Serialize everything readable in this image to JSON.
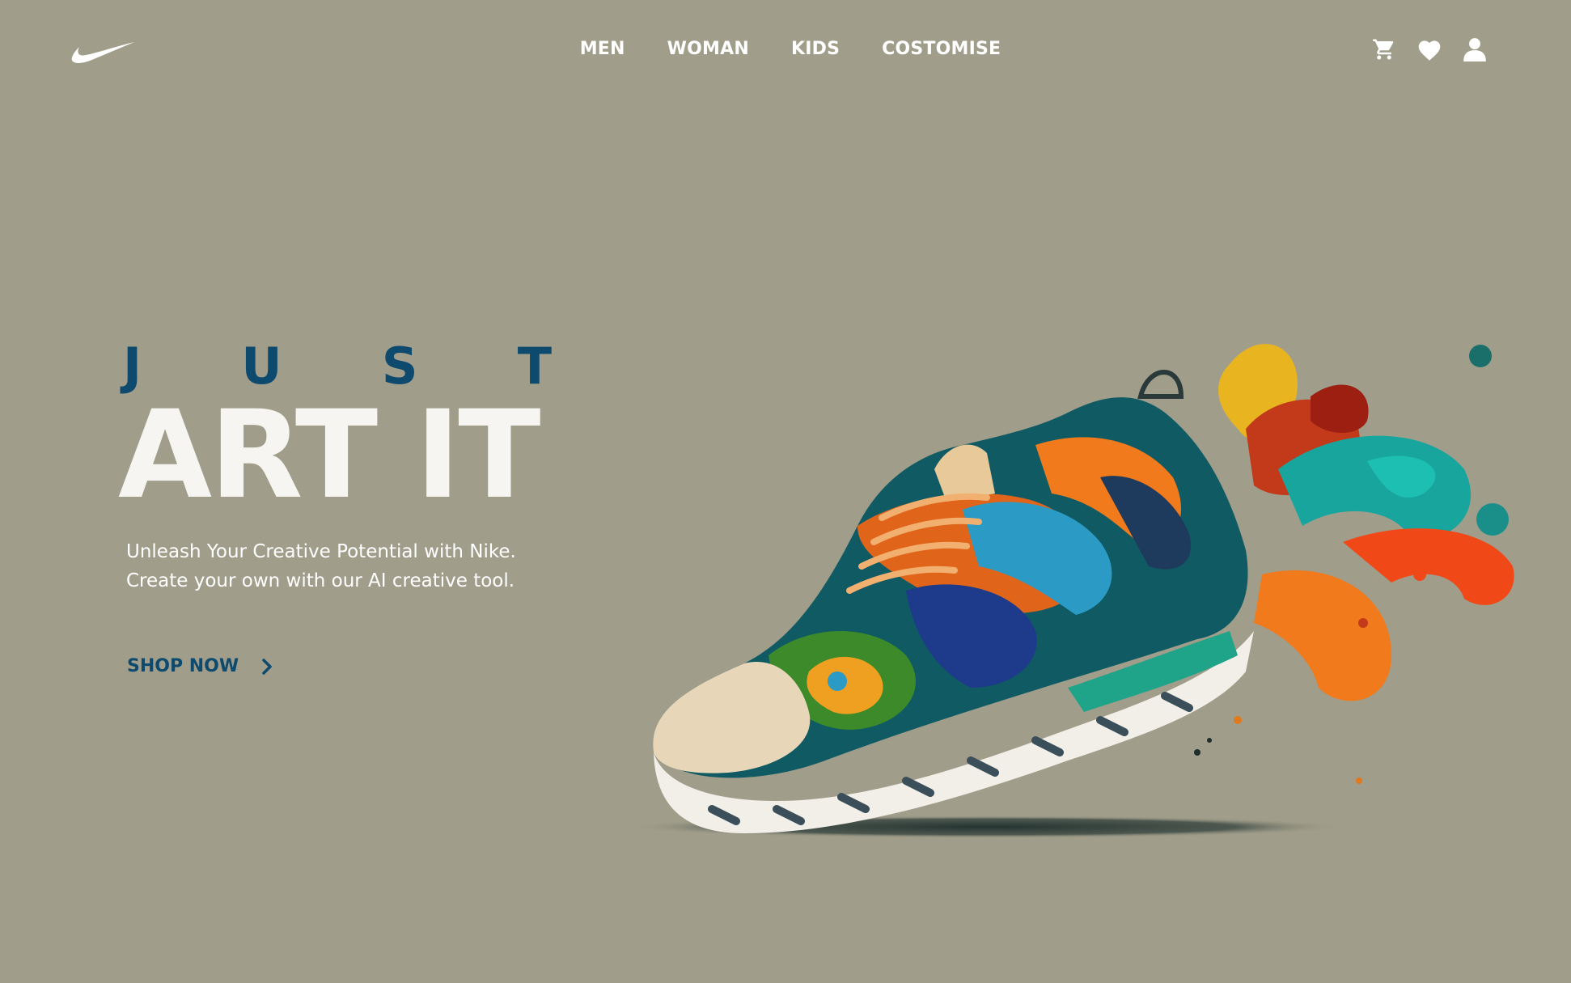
{
  "header": {
    "logo_icon": "swoosh-icon",
    "nav": [
      {
        "label": "MEN"
      },
      {
        "label": "WOMAN"
      },
      {
        "label": "KIDS"
      },
      {
        "label": "COSTOMISE"
      }
    ],
    "icons": [
      "cart-icon",
      "heart-icon",
      "user-icon"
    ]
  },
  "hero": {
    "just_letters": [
      "J",
      "U",
      "S",
      "T"
    ],
    "headline": "ART IT",
    "description_line1": "Unleash Your Creative Potential with Nike.",
    "description_line2": "Create your own with our AI creative tool.",
    "cta_label": "SHOP NOW",
    "cta_icon": "chevron-right-icon"
  },
  "colors": {
    "background": "#a09d8a",
    "accent": "#0e4a6e",
    "headline": "#f7f5f1"
  }
}
